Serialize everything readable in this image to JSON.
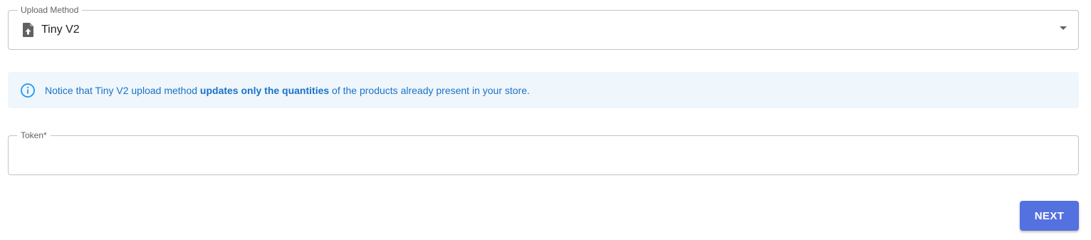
{
  "upload_method": {
    "label": "Upload Method",
    "selected_value": "Tiny V2",
    "icon": "file-upload-icon"
  },
  "notice": {
    "icon": "info-icon",
    "text_before": "Notice that Tiny V2 upload method ",
    "text_bold": "updates only the quantities",
    "text_after": " of the products already present in your store.",
    "color": "#1a73c8",
    "background": "#eff6fc"
  },
  "token": {
    "label": "Token*",
    "value": ""
  },
  "actions": {
    "next_label": "NEXT",
    "next_color": "#5471e0"
  }
}
